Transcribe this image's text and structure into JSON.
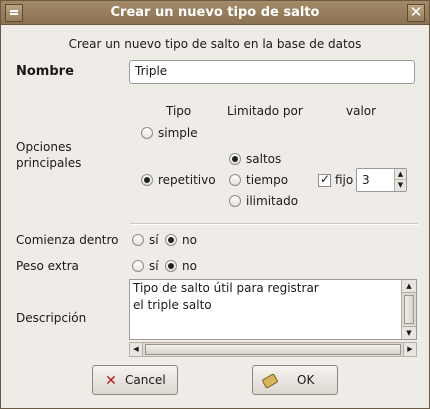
{
  "window": {
    "title": "Crear un nuevo tipo de salto"
  },
  "dialog": {
    "heading": "Crear un nuevo tipo de salto en la base de datos",
    "nombre_label": "Nombre",
    "nombre_value": "Triple",
    "col_tipo": "Tipo",
    "col_limitado": "Limitado por",
    "col_valor": "valor",
    "opciones_line1": "Opciones",
    "opciones_line2": "principales",
    "tipo_options": [
      {
        "label": "simple",
        "selected": false
      },
      {
        "label": "repetitivo",
        "selected": true
      }
    ],
    "limitado_options": [
      {
        "label": "saltos",
        "selected": true
      },
      {
        "label": "tiempo",
        "selected": false
      },
      {
        "label": "ilimitado",
        "selected": false
      }
    ],
    "fijo_label": "fijo",
    "fijo_checked": true,
    "valor": "3",
    "comienza_label": "Comienza dentro",
    "comienza_options": [
      {
        "label": "sí",
        "selected": false
      },
      {
        "label": "no",
        "selected": true
      }
    ],
    "peso_label": "Peso extra",
    "peso_options": [
      {
        "label": "sí",
        "selected": false
      },
      {
        "label": "no",
        "selected": true
      }
    ],
    "descripcion_label": "Descripción",
    "descripcion_lines": [
      "Tipo de salto útil para registrar",
      "el triple salto"
    ]
  },
  "buttons": {
    "cancel": "Cancel",
    "ok": "OK",
    "cancel_icon": "cancel-x-icon",
    "ok_icon": "ok-hand-icon"
  }
}
